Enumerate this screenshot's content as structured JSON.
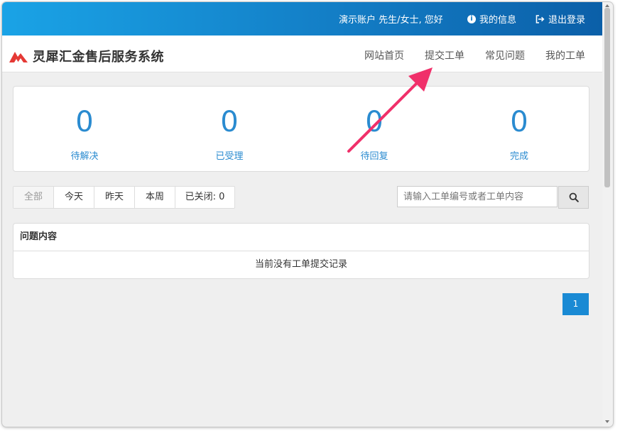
{
  "topbar": {
    "greeting": "演示账户 先生/女士, 您好",
    "info_icon": "info-circle-icon",
    "my_info": "我的信息",
    "logout_icon": "sign-out-icon",
    "logout": "退出登录"
  },
  "brand": {
    "logo_icon": "brand-logo-icon",
    "name": "灵犀汇金售后服务系统",
    "color": "#e53935"
  },
  "nav": {
    "home": "网站首页",
    "submit": "提交工单",
    "faq": "常见问题",
    "my_tickets": "我的工单"
  },
  "stats": [
    {
      "value": "0",
      "label": "待解决"
    },
    {
      "value": "0",
      "label": "已受理"
    },
    {
      "value": "0",
      "label": "待回复"
    },
    {
      "value": "0",
      "label": "完成"
    }
  ],
  "filters": {
    "all": "全部",
    "today": "今天",
    "yesterday": "昨天",
    "week": "本周",
    "closed": "已关闭: 0"
  },
  "search": {
    "placeholder": "请输入工单编号或者工单内容",
    "icon": "search-icon"
  },
  "table": {
    "header": "问题内容",
    "empty": "当前没有工单提交记录"
  },
  "pagination": {
    "current": "1"
  },
  "colors": {
    "accent": "#2a8bd0",
    "topbar_start": "#1aa3e6",
    "topbar_end": "#0b5fa8",
    "annotation": "#f0306a"
  }
}
